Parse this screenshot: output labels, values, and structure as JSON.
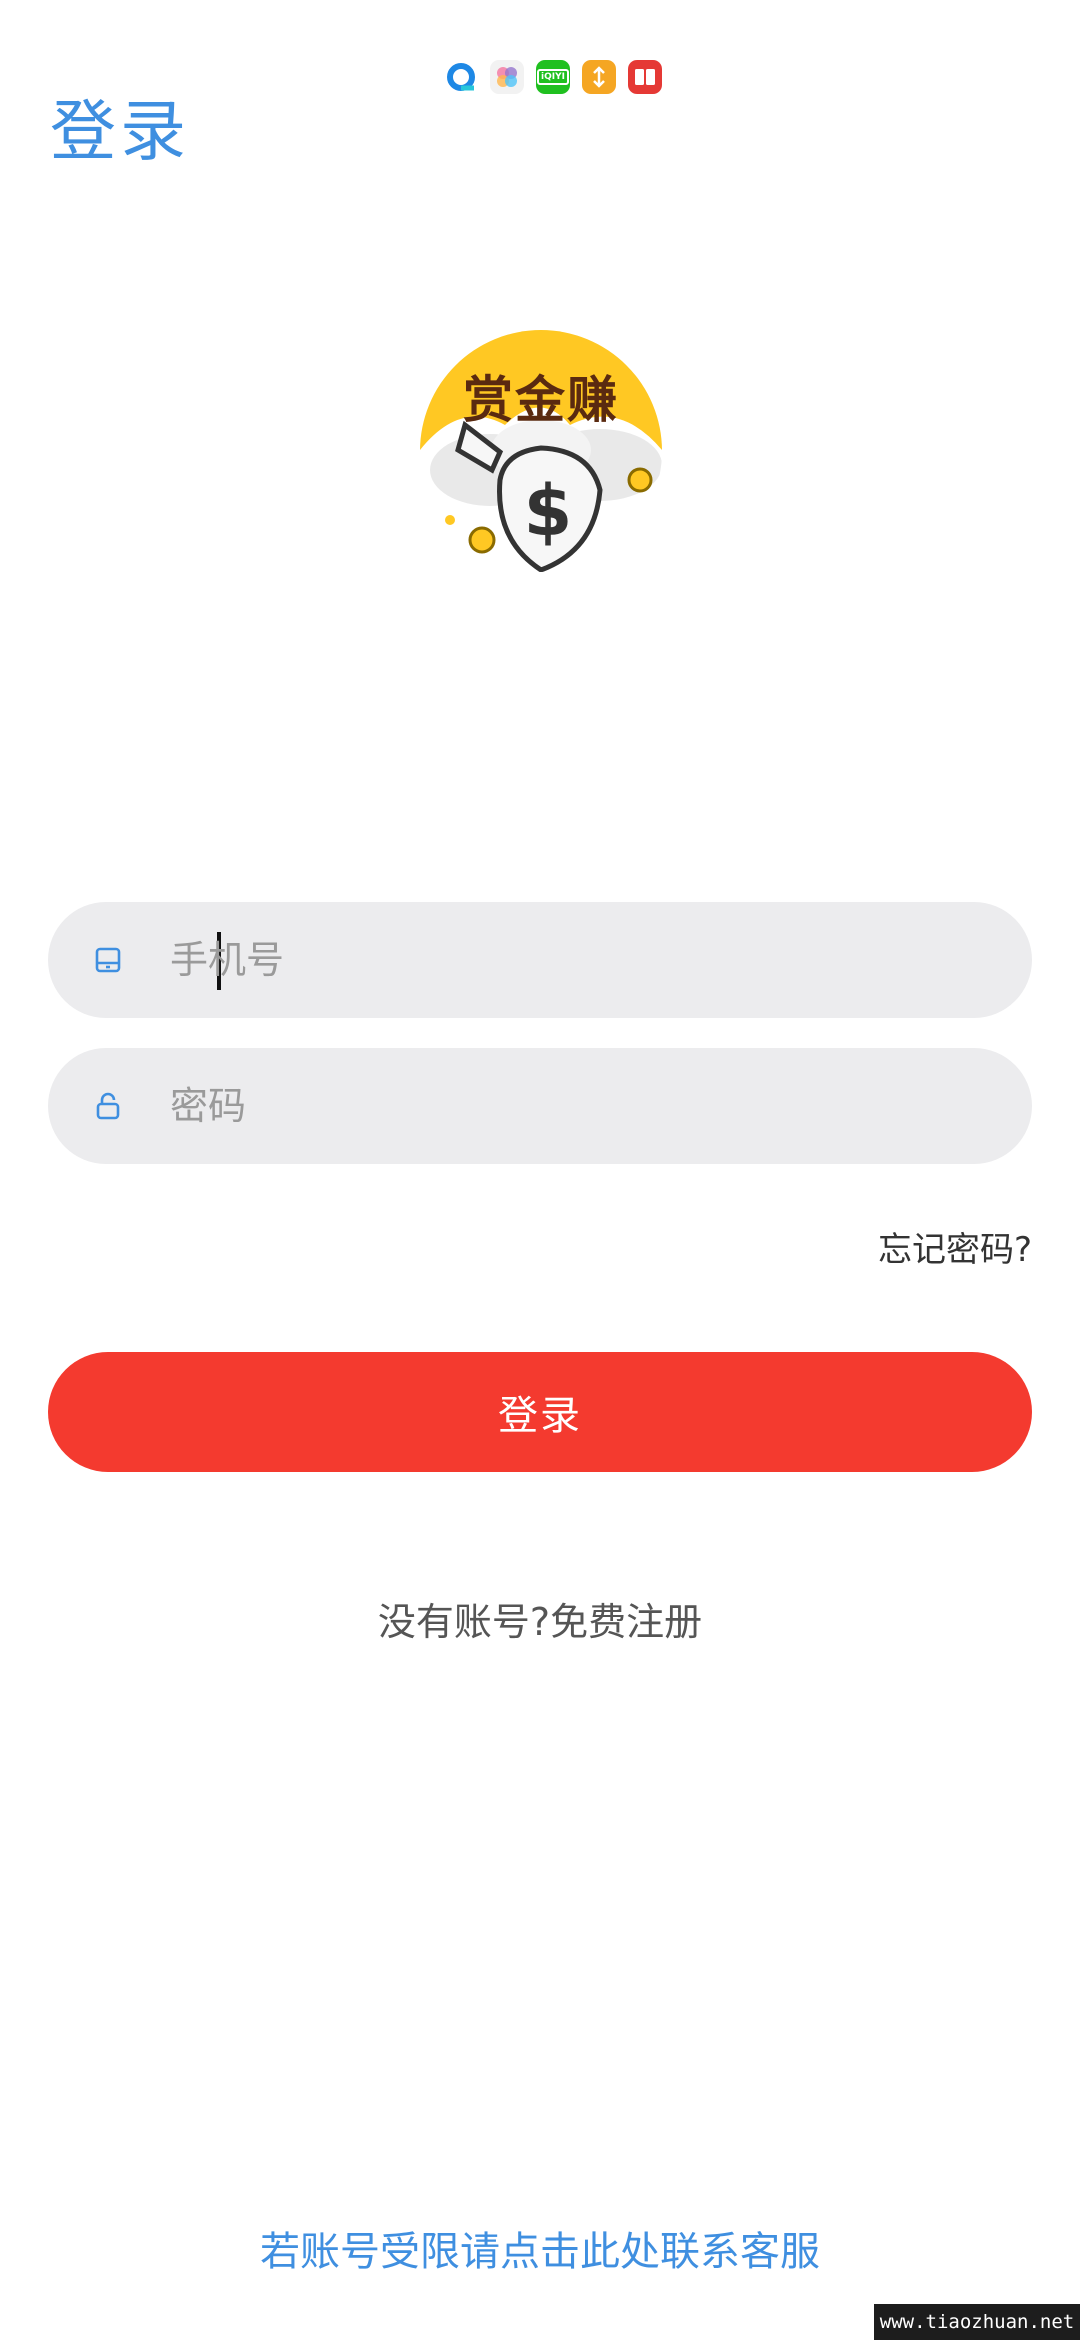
{
  "status_bar": {
    "apps": [
      {
        "name": "qq-browser-icon",
        "color": "#1e88e5"
      },
      {
        "name": "photos-icon",
        "color": "#e57373"
      },
      {
        "name": "iqiyi-icon",
        "color": "#20c020",
        "label": "iQIYI"
      },
      {
        "name": "video-icon",
        "color": "#f5a623"
      },
      {
        "name": "reader-icon",
        "color": "#e53935"
      }
    ]
  },
  "header": {
    "title": "登录"
  },
  "logo": {
    "text": "赏金赚"
  },
  "form": {
    "phone_placeholder": "手机号",
    "password_placeholder": "密码",
    "forgot_label": "忘记密码?",
    "login_label": "登录",
    "register_label": "没有账号?免费注册"
  },
  "footer": {
    "contact_label": "若账号受限请点击此处联系客服",
    "watermark": "www.tiaozhuan.net"
  },
  "colors": {
    "accent": "#3f8fe0",
    "primary_button": "#f43a2f",
    "field_bg": "#ececee"
  }
}
